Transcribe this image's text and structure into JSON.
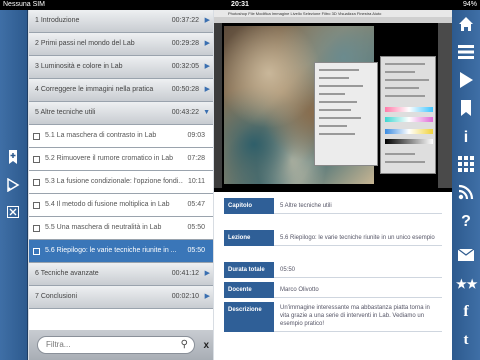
{
  "status_bar": {
    "carrier": "Nessuna SIM",
    "time": "20:31",
    "battery": "94%"
  },
  "left_toolbar": {
    "icons": [
      "bookmark-add-icon",
      "play-list-icon",
      "close-icon"
    ]
  },
  "lesson_list": [
    {
      "type": "chapter",
      "label": "1 Introduzione",
      "duration": "00:37:22",
      "expanded": false
    },
    {
      "type": "chapter",
      "label": "2 Primi passi nel mondo del Lab",
      "duration": "00:29:28",
      "expanded": false
    },
    {
      "type": "chapter",
      "label": "3 Luminosità e colore in Lab",
      "duration": "00:32:05",
      "expanded": false
    },
    {
      "type": "chapter",
      "label": "4 Correggere le immagini nella pratica",
      "duration": "00:50:28",
      "expanded": false
    },
    {
      "type": "chapter",
      "label": "5 Altre tecniche utili",
      "duration": "00:43:22",
      "expanded": true
    },
    {
      "type": "lesson",
      "label": "5.1 La maschera di contrasto in Lab",
      "duration": "09:03",
      "active": false
    },
    {
      "type": "lesson",
      "label": "5.2 Rimuovere il rumore cromatico in Lab",
      "duration": "07:28",
      "active": false
    },
    {
      "type": "lesson",
      "label": "5.3 La fusione condizionale: l'opzione fondi...",
      "duration": "10:11",
      "active": false
    },
    {
      "type": "lesson",
      "label": "5.4 Il metodo di fusione moltiplica in Lab",
      "duration": "05:47",
      "active": false
    },
    {
      "type": "lesson",
      "label": "5.5 Una maschera di neutralità in Lab",
      "duration": "05:50",
      "active": false
    },
    {
      "type": "lesson",
      "label": "5.6 Riepilogo: le varie tecniche riunite in ...",
      "duration": "05:50",
      "active": true
    },
    {
      "type": "chapter",
      "label": "6 Tecniche avanzate",
      "duration": "00:41:12",
      "expanded": false
    },
    {
      "type": "chapter",
      "label": "7 Conclusioni",
      "duration": "00:02:10",
      "expanded": false
    }
  ],
  "search": {
    "placeholder": "Filtra...",
    "value": "",
    "clear": "x"
  },
  "video": {
    "app_menu": "Photoshop  File  Modifica  Immagine  Livello  Selezione  Filtro  3D  Visualizza  Finestra  Aiuto"
  },
  "info": {
    "capitolo_label": "Capitolo",
    "capitolo": "5 Altre tecniche utili",
    "lezione_label": "Lezione",
    "lezione": "5.6 Riepilogo: le varie tecniche riunite in un unico esempio",
    "durata_label": "Durata totale",
    "durata": "05:50",
    "docente_label": "Docente",
    "docente": "Marco Olivotto",
    "descrizione_label": "Descrizione",
    "descrizione": "Un'immagine interessante ma abbastanza piatta torna in vita grazie a una serie di interventi in Lab. Vediamo un esempio pratico!"
  },
  "right_toolbar": {
    "icons": [
      "home-icon",
      "list-icon",
      "play-icon",
      "bookmark-icon",
      "info-icon",
      "grid-icon",
      "rss-icon",
      "help-icon",
      "mail-icon",
      "rating-stars-icon",
      "facebook-icon",
      "twitter-icon"
    ]
  },
  "colors": {
    "accent": "#3a76b8",
    "sidebar": "#2d5a8e",
    "info_key": "#2f5f97"
  }
}
